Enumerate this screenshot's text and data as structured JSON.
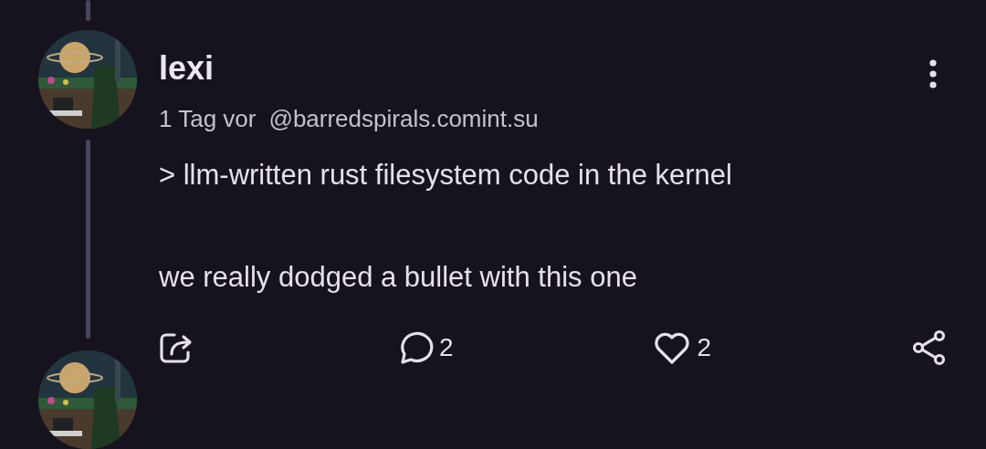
{
  "post": {
    "author": "lexi",
    "time": "1 Tag vor",
    "handle": "@barredspirals.comint.su",
    "body": [
      "> llm-written rust filesystem code in the kernel",
      "we really dodged a bullet with this one"
    ],
    "actions": [
      {
        "kind": "boost"
      },
      {
        "kind": "reply",
        "count": "2"
      },
      {
        "kind": "like",
        "count": "2"
      },
      {
        "kind": "share"
      }
    ]
  }
}
